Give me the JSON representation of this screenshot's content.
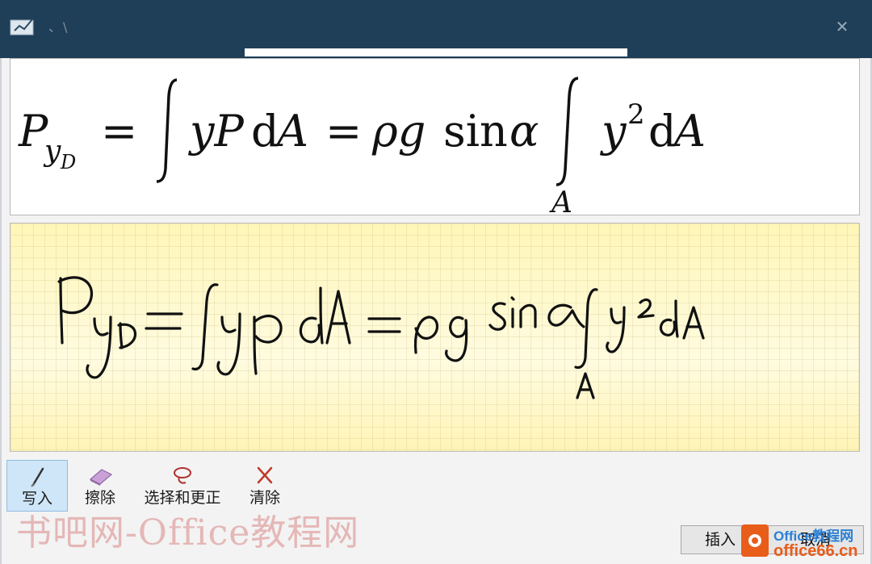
{
  "titlebar": {
    "title": "、\\",
    "close_symbol": "✕"
  },
  "preview": {
    "formula": "P_{y_D} = ∫ yPdA = ρg sin α ∫_A y²dA"
  },
  "ink": {
    "handwriting": "Py_D = ∫ yp dA = ρg sinα ∫_A y²dA"
  },
  "toolbar": {
    "write_label": "写入",
    "erase_label": "擦除",
    "select_correct_label": "选择和更正",
    "clear_label": "清除"
  },
  "footer": {
    "insert_label": "插入",
    "cancel_label": "取消",
    "watermark": "书吧网-Office教程网",
    "logo_top": "Office教程网",
    "logo_bottom": "office66.cn"
  },
  "colors": {
    "titlebar": "#1f3e57",
    "ink_background": "#fff9c8",
    "active_tool": "#cfe6f8"
  }
}
